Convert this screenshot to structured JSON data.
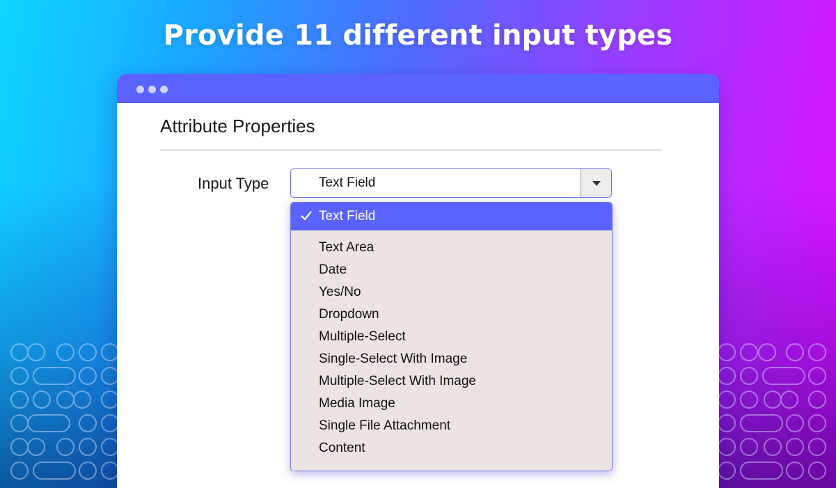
{
  "hero": {
    "title": "Provide 11 different input types"
  },
  "panel": {
    "title": "Attribute Properties"
  },
  "input_type": {
    "label": "Input Type",
    "selected_value": "Text Field",
    "options": [
      "Text Field",
      "Text Area",
      "Date",
      "Yes/No",
      "Dropdown",
      "Multiple-Select",
      "Single-Select With Image",
      "Multiple-Select With Image",
      "Media Image",
      "Single File Attachment",
      "Content"
    ]
  },
  "icons": {
    "window_dots": "window-control-dots",
    "dropdown_arrow": "triangle-down-icon",
    "selected_mark": "checkmark-icon"
  },
  "colors": {
    "accent": "#5a62ff",
    "dropdown_bg": "#ede3e3",
    "text": "#111111"
  }
}
